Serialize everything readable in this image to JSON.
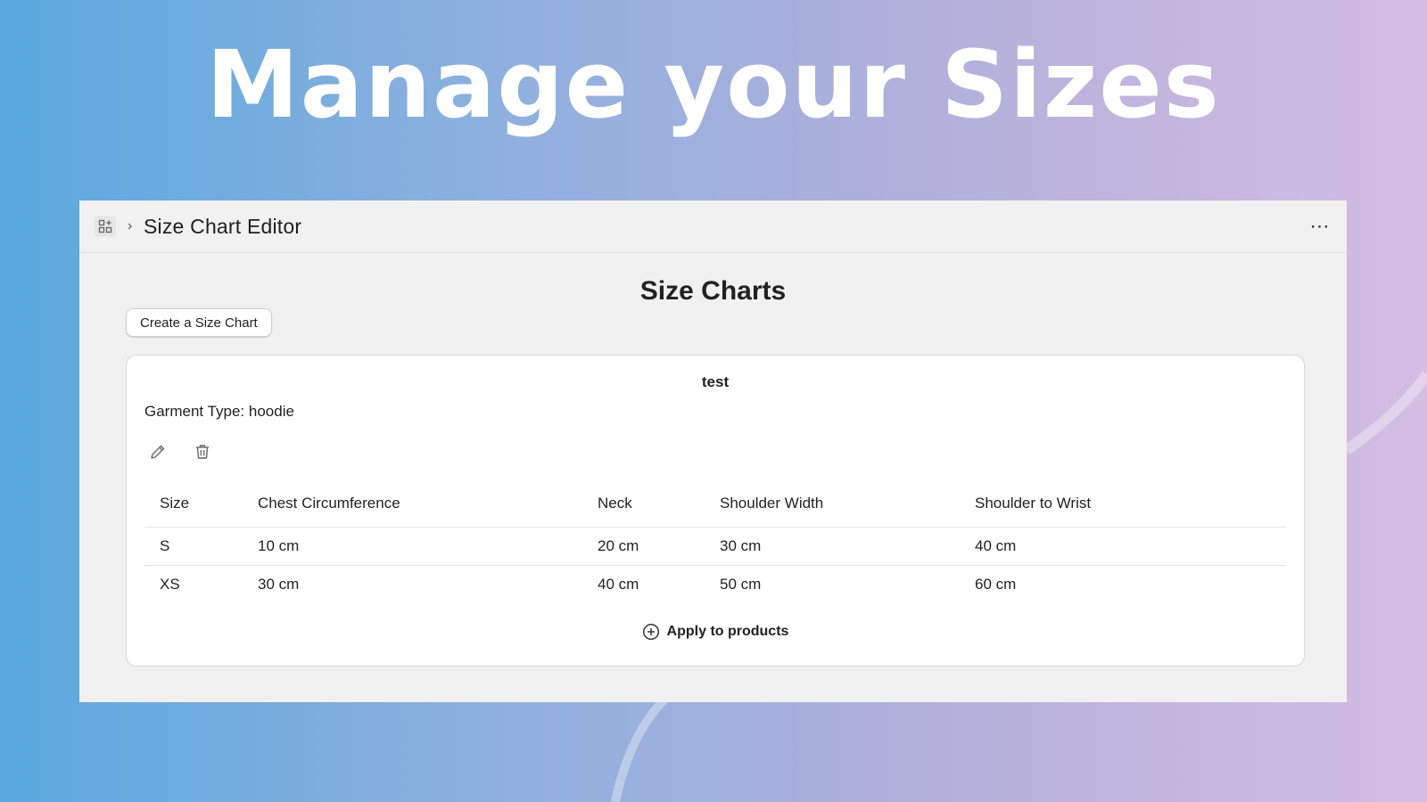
{
  "hero": {
    "title": "Manage your Sizes"
  },
  "window": {
    "app_title": "Size Chart Editor",
    "breadcrumb_separator": "›",
    "more_label": "⋯",
    "icons": [
      "apps-icon",
      "chevron-right-icon",
      "more-horizontal-icon"
    ]
  },
  "page": {
    "heading": "Size Charts",
    "create_button_label": "Create a Size Chart"
  },
  "chart_card": {
    "name": "test",
    "garment_label": "Garment Type:",
    "garment_value": "hoodie",
    "icons": [
      "pencil-icon",
      "trash-icon",
      "plus-circle-icon"
    ],
    "columns": [
      "Size",
      "Chest Circumference",
      "Neck",
      "Shoulder Width",
      "Shoulder to Wrist"
    ],
    "rows": [
      [
        "S",
        "10 cm",
        "20 cm",
        "30 cm",
        "40 cm"
      ],
      [
        "XS",
        "30 cm",
        "40 cm",
        "50 cm",
        "60 cm"
      ]
    ],
    "apply_label": "Apply to products"
  },
  "colors": {
    "gradient_start": "#5aa9df",
    "gradient_end": "#d4bde2",
    "window_bg": "#f1f1f1",
    "card_bg": "#ffffff",
    "text": "#222222"
  }
}
